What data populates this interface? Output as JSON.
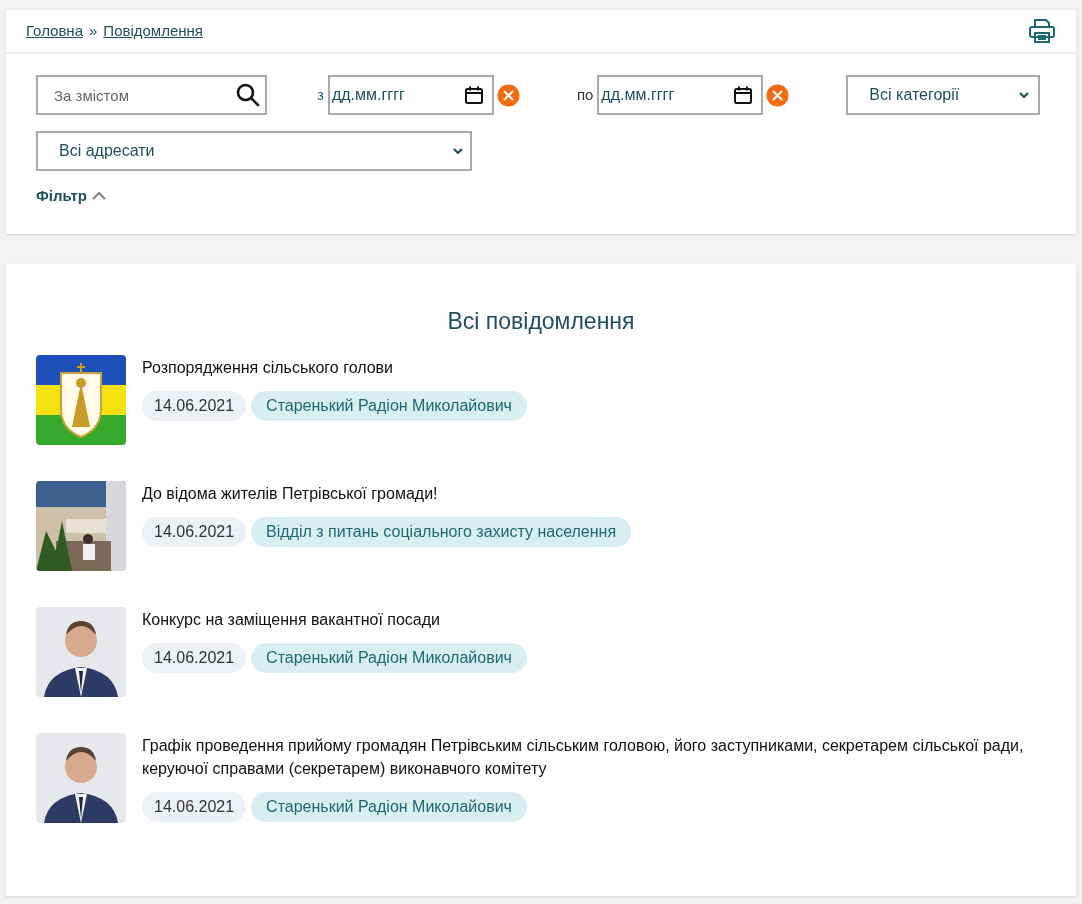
{
  "breadcrumbs": [
    "Головна",
    "Повідомлення"
  ],
  "breadcrumb_separator": "»",
  "filters": {
    "search": {
      "placeholder": "За змістом"
    },
    "date_from": {
      "label": "з",
      "value": "дд.мм.гггг"
    },
    "date_to": {
      "label": "по",
      "value": "дд.мм.гггг"
    },
    "category": {
      "value": "Всі категорії"
    },
    "recipient": {
      "value": "Всі адресати"
    },
    "toggle": {
      "label": "Фільтр",
      "expanded": true
    }
  },
  "heading": "Всі повідомлення",
  "messages": [
    {
      "title": "Розпорядження сільського голови",
      "date": "14.06.2021",
      "author": "Старенький Радіон Миколайович"
    },
    {
      "title": "До відома жителів Петрівської громади!",
      "date": "14.06.2021",
      "author": "Відділ з питань соціального захисту населення"
    },
    {
      "title": "Конкурс на заміщення вакантної посади",
      "date": "14.06.2021",
      "author": "Старенький Радіон Миколайович"
    },
    {
      "title": "Графік проведення прийому громадян Петрівським сільським головою, його заступниками, секретарем сільської ради, керуючої справами (секретарем) виконавчого комітету",
      "date": "14.06.2021",
      "author": "Старенький Радіон Миколайович"
    }
  ]
}
